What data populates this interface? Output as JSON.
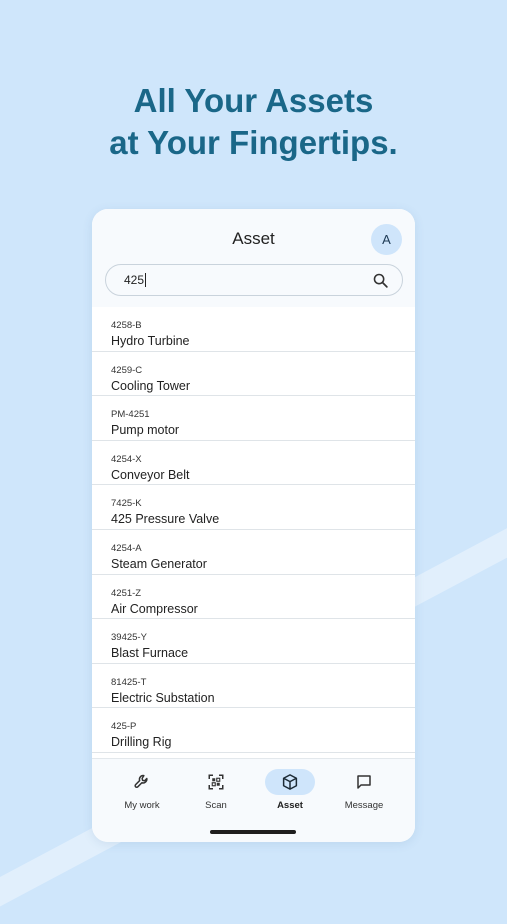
{
  "headline": {
    "line1": "All Your Assets",
    "line2": "at Your Fingertips."
  },
  "app": {
    "title": "Asset",
    "avatar_initial": "A",
    "search": {
      "value": "425",
      "icon": "search-icon"
    },
    "assets": [
      {
        "code": "4258-B",
        "name": "Hydro Turbine"
      },
      {
        "code": "4259-C",
        "name": "Cooling Tower"
      },
      {
        "code": "PM-4251",
        "name": "Pump motor"
      },
      {
        "code": "4254-X",
        "name": "Conveyor Belt"
      },
      {
        "code": "7425-K",
        "name": "425 Pressure Valve"
      },
      {
        "code": "4254-A",
        "name": "Steam Generator"
      },
      {
        "code": "4251-Z",
        "name": "Air Compressor"
      },
      {
        "code": "39425-Y",
        "name": "Blast Furnace"
      },
      {
        "code": "81425-T",
        "name": "Electric Substation"
      },
      {
        "code": "425-P",
        "name": "Drilling Rig"
      }
    ],
    "nav": [
      {
        "label": "My work",
        "icon": "wrench-icon",
        "active": false
      },
      {
        "label": "Scan",
        "icon": "qr-scan-icon",
        "active": false
      },
      {
        "label": "Asset",
        "icon": "cube-icon",
        "active": true
      },
      {
        "label": "Message",
        "icon": "message-icon",
        "active": false
      }
    ]
  },
  "colors": {
    "background": "#cfe6fb",
    "headline": "#1a6788",
    "active_pill": "#cfe5fb"
  }
}
